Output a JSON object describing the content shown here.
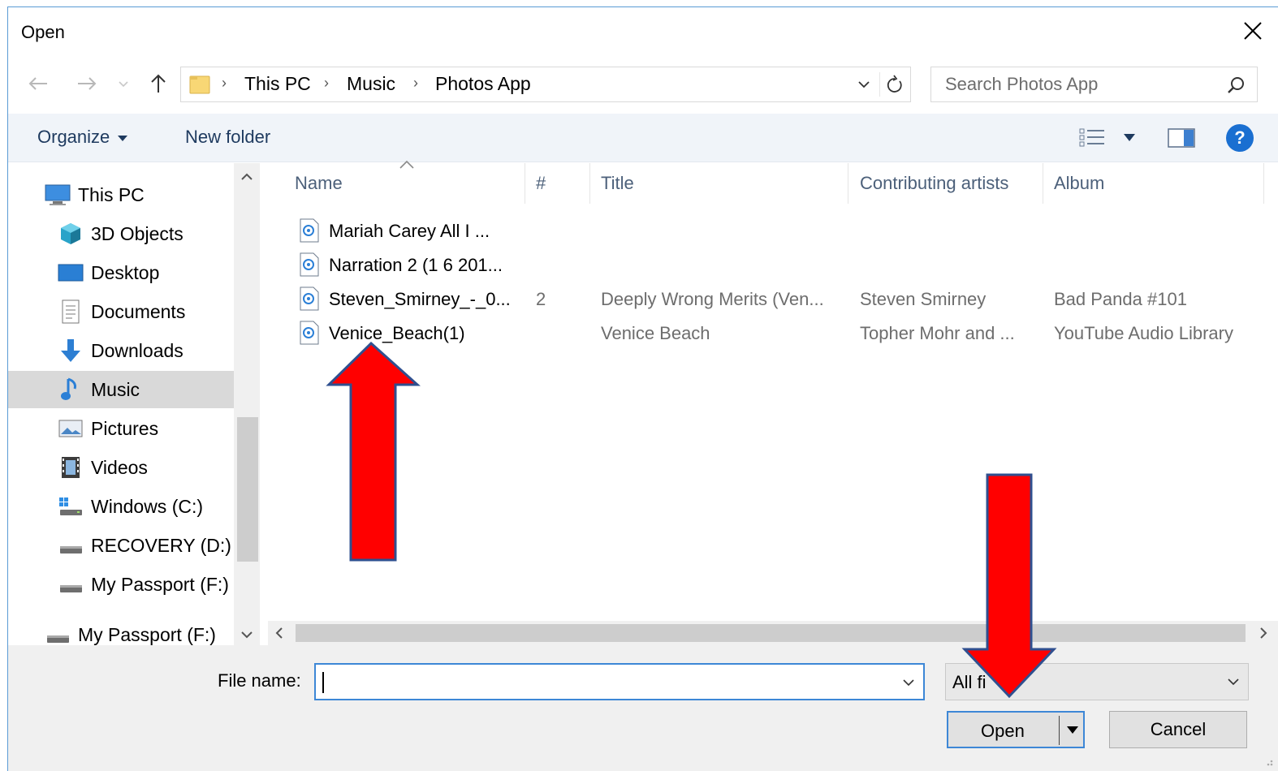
{
  "window": {
    "title": "Open"
  },
  "address": {
    "crumbs": [
      "This PC",
      "Music",
      "Photos App"
    ]
  },
  "search": {
    "placeholder": "Search Photos App"
  },
  "toolbar": {
    "organize_label": "Organize",
    "new_folder_label": "New folder",
    "help_label": "?"
  },
  "nav_pane": {
    "items": [
      {
        "label": "This PC",
        "icon": "computer-icon"
      },
      {
        "label": "3D Objects",
        "icon": "cube-icon"
      },
      {
        "label": "Desktop",
        "icon": "desktop-icon"
      },
      {
        "label": "Documents",
        "icon": "documents-icon"
      },
      {
        "label": "Downloads",
        "icon": "download-arrow-icon"
      },
      {
        "label": "Music",
        "icon": "music-note-icon",
        "selected": true
      },
      {
        "label": "Pictures",
        "icon": "pictures-icon"
      },
      {
        "label": "Videos",
        "icon": "film-icon"
      },
      {
        "label": "Windows (C:)",
        "icon": "windows-drive-icon"
      },
      {
        "label": "RECOVERY (D:)",
        "icon": "drive-icon"
      },
      {
        "label": "My Passport (F:)",
        "icon": "drive-icon"
      },
      {
        "label": "My Passport (F:)",
        "icon": "drive-icon"
      }
    ]
  },
  "file_list": {
    "columns": [
      "Name",
      "#",
      "Title",
      "Contributing artists",
      "Album"
    ],
    "rows": [
      {
        "name": "Mariah Carey   All I ...",
        "number": "",
        "title": "",
        "artists": "",
        "album": ""
      },
      {
        "name": "Narration 2 (1 6 201...",
        "number": "",
        "title": "",
        "artists": "",
        "album": ""
      },
      {
        "name": "Steven_Smirney_-_0...",
        "number": "2",
        "title": "Deeply Wrong Merits (Ven...",
        "artists": "Steven Smirney",
        "album": "Bad Panda #101"
      },
      {
        "name": "Venice_Beach(1)",
        "number": "",
        "title": "Venice Beach",
        "artists": "Topher Mohr and ...",
        "album": "YouTube Audio Library"
      }
    ]
  },
  "bottom": {
    "file_name_label": "File name:",
    "file_name_value": "",
    "filter_value": "All fi",
    "open_label": "Open",
    "cancel_label": "Cancel"
  },
  "colors": {
    "accent": "#3d87d6",
    "annotation_arrow": "#ff0000",
    "annotation_outline": "#2f4f8f"
  }
}
